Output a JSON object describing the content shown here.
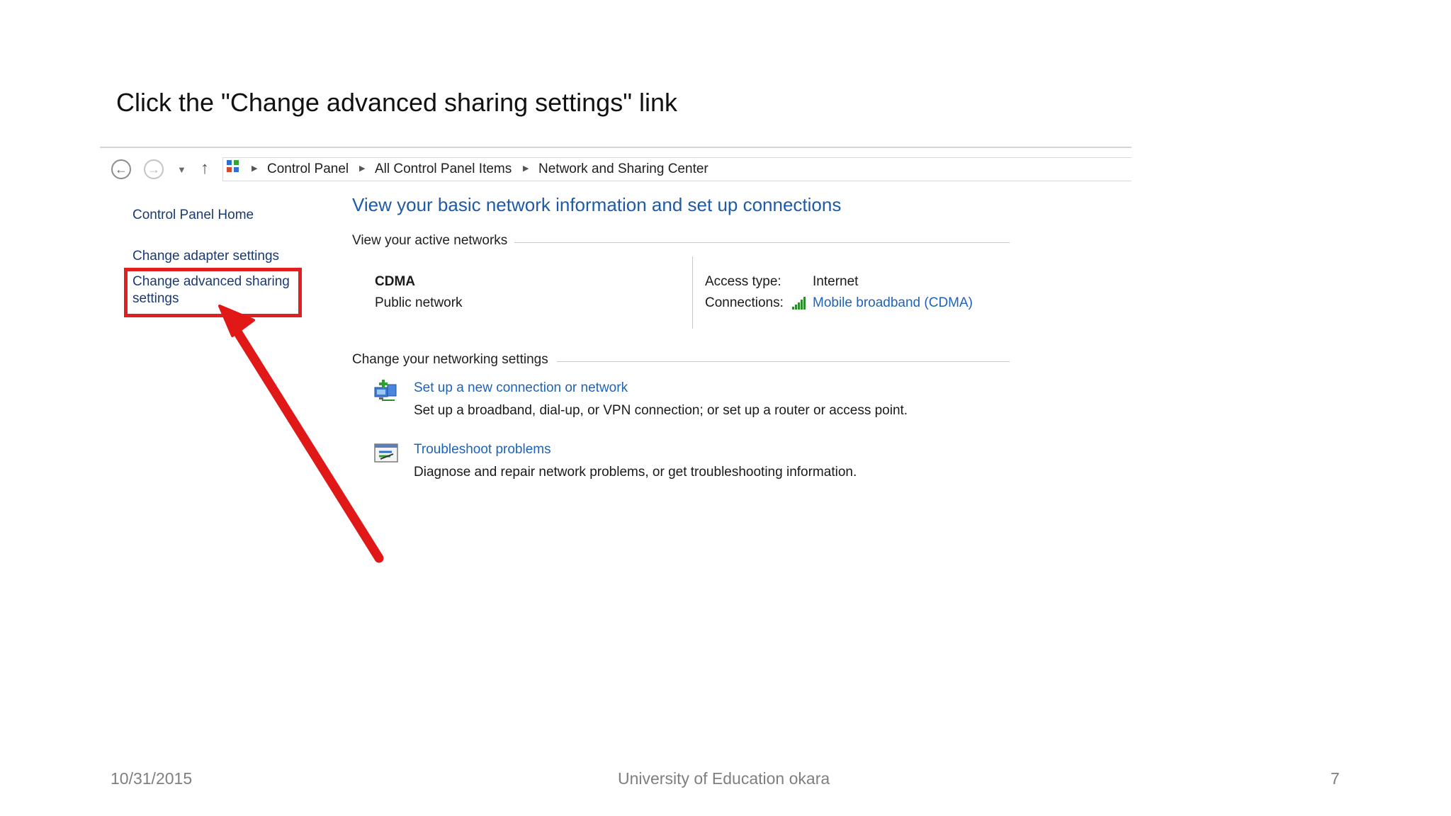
{
  "slide": {
    "title": "Click the \"Change advanced sharing settings\" link",
    "footer_date": "10/31/2015",
    "footer_center": "University of Education okara",
    "page_number": "7"
  },
  "toolbar": {
    "back_icon": "back-arrow-icon",
    "forward_icon": "forward-arrow-icon",
    "recent_icon": "chevron-down-icon",
    "up_icon": "up-arrow-icon"
  },
  "breadcrumb": {
    "items": [
      "Control Panel",
      "All Control Panel Items",
      "Network and Sharing Center"
    ]
  },
  "sidebar": {
    "home": "Control Panel Home",
    "adapter": "Change adapter settings",
    "advanced_line1": "Change advanced sharing",
    "advanced_line2": "settings"
  },
  "main": {
    "heading": "View your basic network information and set up connections",
    "active_networks_label": "View your active networks",
    "network": {
      "name": "CDMA",
      "type": "Public network",
      "access_type_label": "Access type:",
      "access_type_value": "Internet",
      "connections_label": "Connections:",
      "connections_value": "Mobile broadband (CDMA)"
    },
    "change_settings_label": "Change your networking settings",
    "tasks": [
      {
        "link": "Set up a new connection or network",
        "description": "Set up a broadband, dial-up, or VPN connection; or set up a router or access point."
      },
      {
        "link": "Troubleshoot problems",
        "description": "Diagnose and repair network problems, or get troubleshooting information."
      }
    ]
  },
  "colors": {
    "highlight": "#e02020",
    "link": "#1e63b8",
    "heading": "#1f5aa8"
  }
}
